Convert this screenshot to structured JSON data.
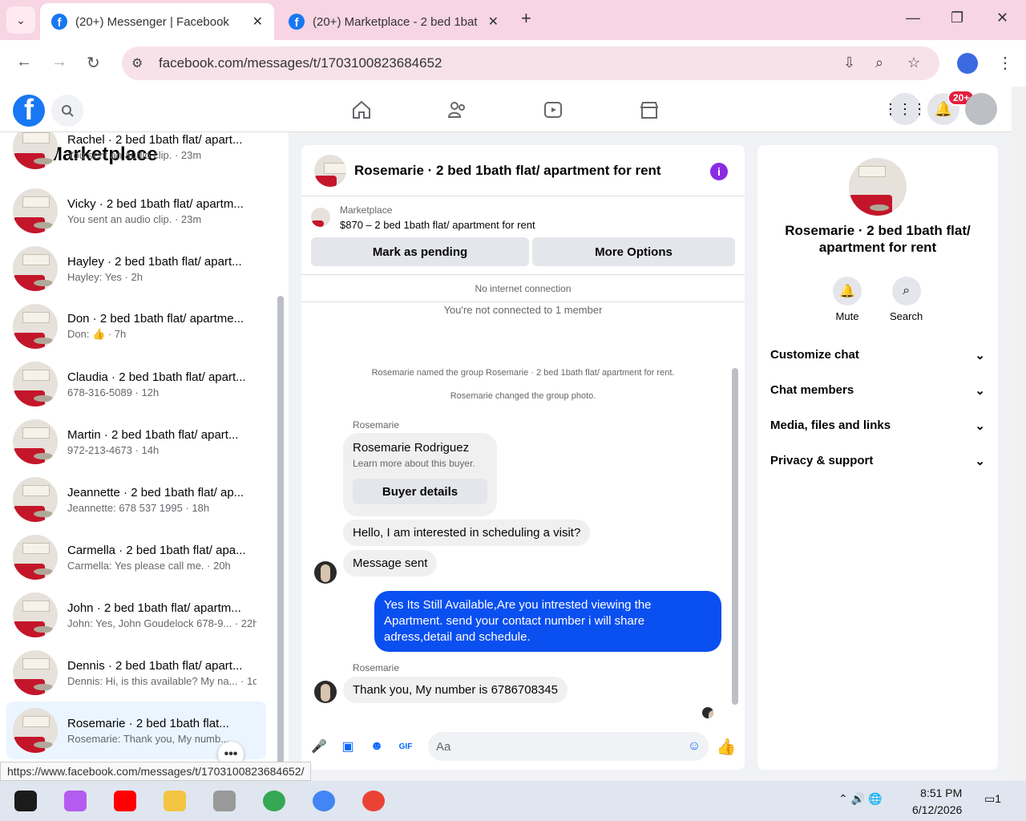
{
  "browser": {
    "tabs": [
      {
        "title": "(20+) Messenger | Facebook",
        "active": true
      },
      {
        "title": "(20+) Marketplace - 2 bed 1bat",
        "active": false
      }
    ],
    "url": "facebook.com/messages/t/1703100823684652",
    "status_url": "https://www.facebook.com/messages/t/1703100823684652/"
  },
  "fb": {
    "notif_badge": "20+"
  },
  "sidebar": {
    "title": "Marketplace",
    "conversations": [
      {
        "name": "Rachel · 2 bed 1bath flat/ apart...",
        "meta": "You sent an audio clip. · 23m"
      },
      {
        "name": "Vicky · 2 bed 1bath flat/ apartm...",
        "meta": "You sent an audio clip. · 23m"
      },
      {
        "name": "Hayley · 2 bed 1bath flat/ apart...",
        "meta": "Hayley: Yes · 2h"
      },
      {
        "name": "Don · 2 bed 1bath flat/ apartme...",
        "meta": "Don: 👍 · 7h"
      },
      {
        "name": "Claudia · 2 bed 1bath flat/ apart...",
        "meta": "678-316-5089 · 12h"
      },
      {
        "name": "Martin · 2 bed 1bath flat/ apart...",
        "meta": "972-213-4673 · 14h"
      },
      {
        "name": "Jeannette · 2 bed 1bath flat/ ap...",
        "meta": "Jeannette: 678 537 1995 · 18h"
      },
      {
        "name": "Carmella · 2 bed 1bath flat/ apa...",
        "meta": "Carmella: Yes please call me. · 20h"
      },
      {
        "name": "John · 2 bed 1bath flat/ apartm...",
        "meta": "John: Yes, John Goudelock 678-9... · 22h"
      },
      {
        "name": "Dennis · 2 bed 1bath flat/ apart...",
        "meta": "Dennis: Hi, is this available? My na... · 1d"
      },
      {
        "name": "Rosemarie · 2 bed 1bath flat...",
        "meta": "Rosemarie: Thank you, My numb..."
      }
    ]
  },
  "chat": {
    "title": "Rosemarie · 2 bed 1bath flat/ apartment for rent",
    "marketplace_label": "Marketplace",
    "listing": "$870 – 2 bed 1bath flat/ apartment for rent",
    "btn_pending": "Mark as pending",
    "btn_more": "More Options",
    "no_internet": "No internet connection",
    "not_connected": "You're not connected to 1 member",
    "sys1": "Rosemarie named the group Rosemarie · 2 bed 1bath flat/ apartment for rent.",
    "sys2": "Rosemarie changed the group photo.",
    "sender": "Rosemarie",
    "buyer_name": "Rosemarie Rodriguez",
    "buyer_sub": "Learn more about this buyer.",
    "buyer_btn": "Buyer details",
    "msg1": "Hello, I am interested in scheduling a visit?",
    "msg2": "Message sent",
    "msg_out": "Yes Its Still Available,Are you intrested viewing the Apartment. send your contact number i will share adress,detail and schedule.",
    "msg3": "Thank you, My number is 6786708345",
    "compose_placeholder": "Aa"
  },
  "details": {
    "name": "Rosemarie · 2 bed 1bath flat/ apartment for rent",
    "mute": "Mute",
    "search": "Search",
    "sections": [
      "Customize chat",
      "Chat members",
      "Media, files and links",
      "Privacy & support"
    ]
  },
  "taskbar": {
    "time": "8:51 PM",
    "date": "6/12/2026",
    "notif_count": "1"
  }
}
